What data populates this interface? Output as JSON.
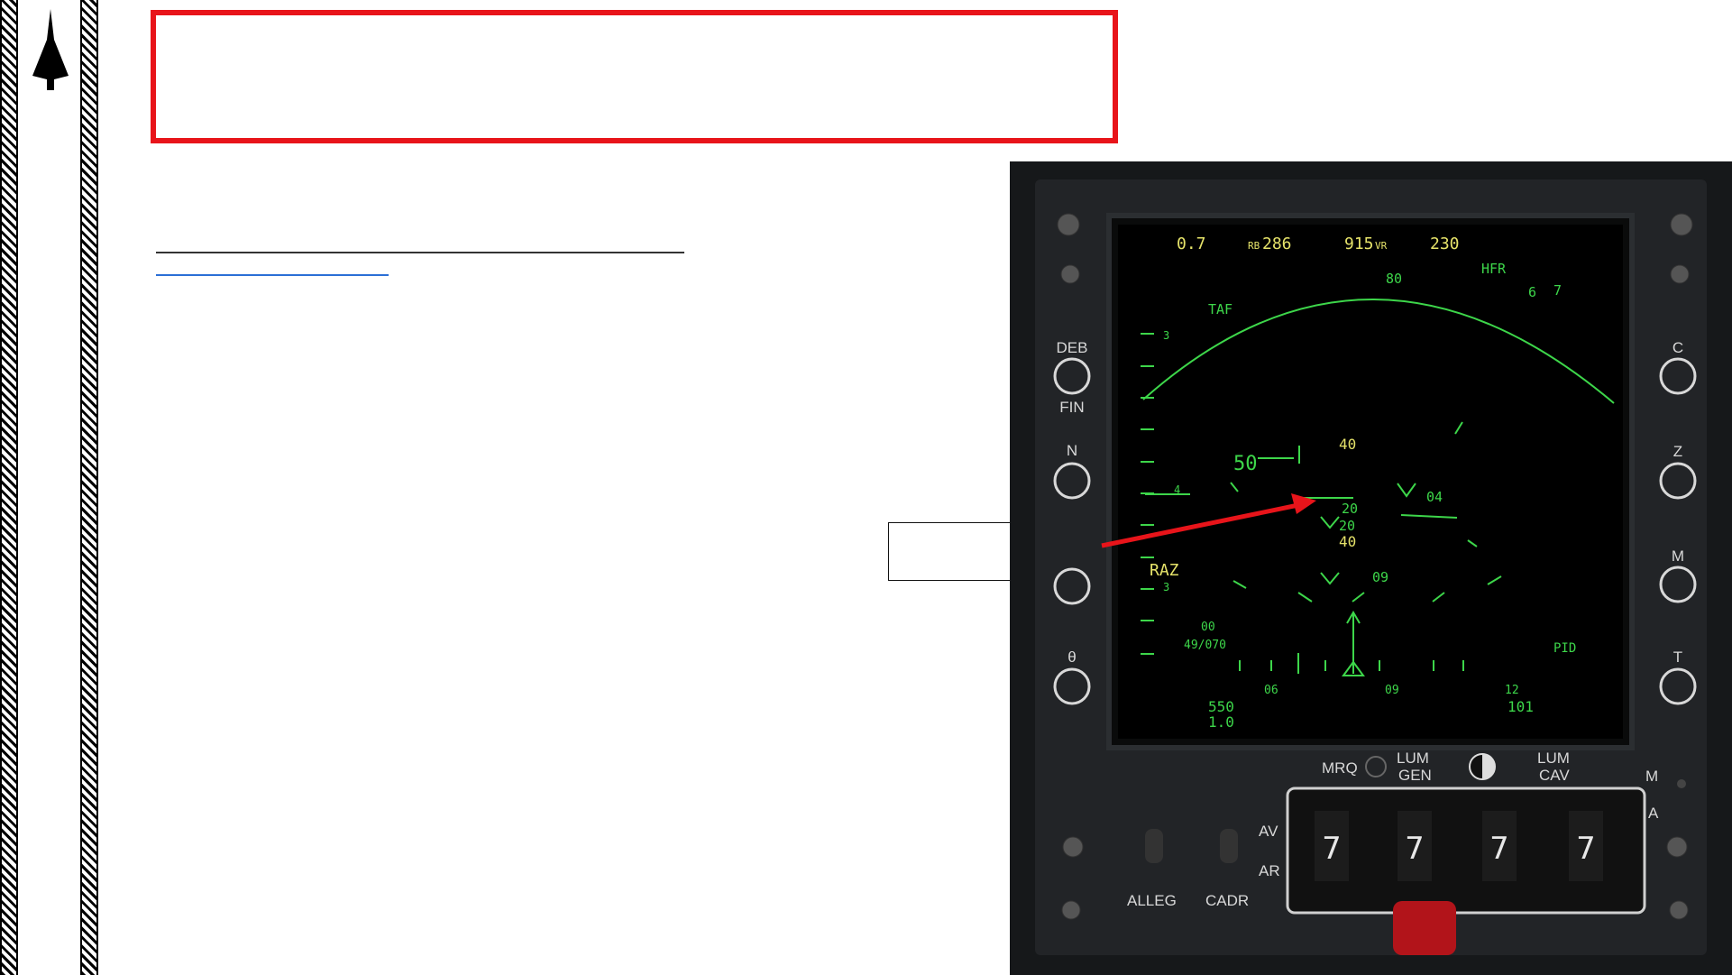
{
  "panel": {
    "top_row": {
      "mach": "0.7",
      "rb_prefix": "RB",
      "rb_value": "286",
      "vr_value": "915",
      "vr_suffix": "VR",
      "speed": "230"
    },
    "arc": {
      "label_80": "80",
      "hfr": "HFR",
      "n6": "6",
      "n7": "7",
      "taf": "TAF",
      "n3": "3"
    },
    "center": {
      "n40": "40",
      "n50": "50",
      "v04": "04",
      "v20": "20",
      "n20": "20",
      "n40b": "40",
      "v09": "09"
    },
    "left_marks": {
      "n4": "4",
      "n3b": "3"
    },
    "bottom": {
      "t00": "00",
      "t49": "49/070",
      "pid": "PID",
      "raz": "RAZ",
      "t550": "550",
      "t10": "1.0",
      "s06": "06",
      "s09": "09",
      "s12": "12",
      "t101": "101"
    },
    "left_buttons": {
      "deb": "DEB",
      "fin": "FIN",
      "n": "N",
      "theta": "θ"
    },
    "right_buttons": {
      "c": "C",
      "z": "Z",
      "m": "M",
      "t": "T"
    },
    "lower_panel": {
      "mrq": "MRQ",
      "lum_gen_1": "LUM",
      "lum_gen_2": "GEN",
      "lum_cav_1": "LUM",
      "lum_cav_2": "CAV",
      "m": "M",
      "a": "A",
      "av": "AV",
      "ar": "AR",
      "alleg": "ALLEG",
      "cadr": "CADR",
      "digits": [
        "7",
        "7",
        "7",
        "7"
      ]
    }
  },
  "colors": {
    "red": "#e8141a",
    "screen_green": "#3dd64a",
    "screen_yellow": "#e6e36a"
  }
}
